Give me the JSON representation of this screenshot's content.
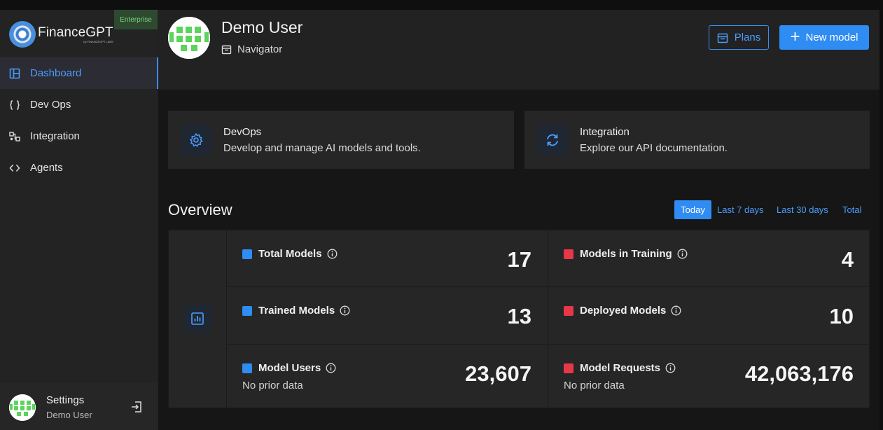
{
  "app": {
    "brand": "FinanceGPT",
    "brand_sub": "by FINANCEGPT LABS",
    "plan_badge": "Enterprise"
  },
  "sidebar": {
    "items": [
      {
        "label": "Dashboard",
        "icon": "layout-icon",
        "active": true
      },
      {
        "label": "Dev Ops",
        "icon": "braces-icon",
        "active": false
      },
      {
        "label": "Integration",
        "icon": "network-icon",
        "active": false
      },
      {
        "label": "Agents",
        "icon": "code-icon",
        "active": false
      }
    ],
    "footer": {
      "title": "Settings",
      "user": "Demo User",
      "logout_icon": "logout-icon"
    }
  },
  "header": {
    "user_name": "Demo User",
    "role": "Navigator",
    "plans_label": "Plans",
    "new_model_label": "New model"
  },
  "cards": [
    {
      "title": "DevOps",
      "desc": "Develop and manage AI models and tools.",
      "icon": "gear-icon"
    },
    {
      "title": "Integration",
      "desc": "Explore our API documentation.",
      "icon": "refresh-icon"
    }
  ],
  "overview": {
    "title": "Overview",
    "tabs": [
      {
        "label": "Today",
        "active": true
      },
      {
        "label": "Last 7 days",
        "active": false
      },
      {
        "label": "Last 30 days",
        "active": false
      },
      {
        "label": "Total",
        "active": false
      }
    ],
    "stats": [
      {
        "label": "Total Models",
        "value": "17",
        "color": "#2f8cf2",
        "note": ""
      },
      {
        "label": "Models in Training",
        "value": "4",
        "color": "#e8374a",
        "note": ""
      },
      {
        "label": "Trained Models",
        "value": "13",
        "color": "#2f8cf2",
        "note": ""
      },
      {
        "label": "Deployed Models",
        "value": "10",
        "color": "#e8374a",
        "note": ""
      },
      {
        "label": "Model Users",
        "value": "23,607",
        "color": "#2f8cf2",
        "note": "No prior data"
      },
      {
        "label": "Model Requests",
        "value": "42,063,176",
        "color": "#e8374a",
        "note": "No prior data"
      }
    ]
  },
  "colors": {
    "accent": "#2f8cf2",
    "alert": "#e8374a",
    "badge_green": "#7fd07f"
  }
}
